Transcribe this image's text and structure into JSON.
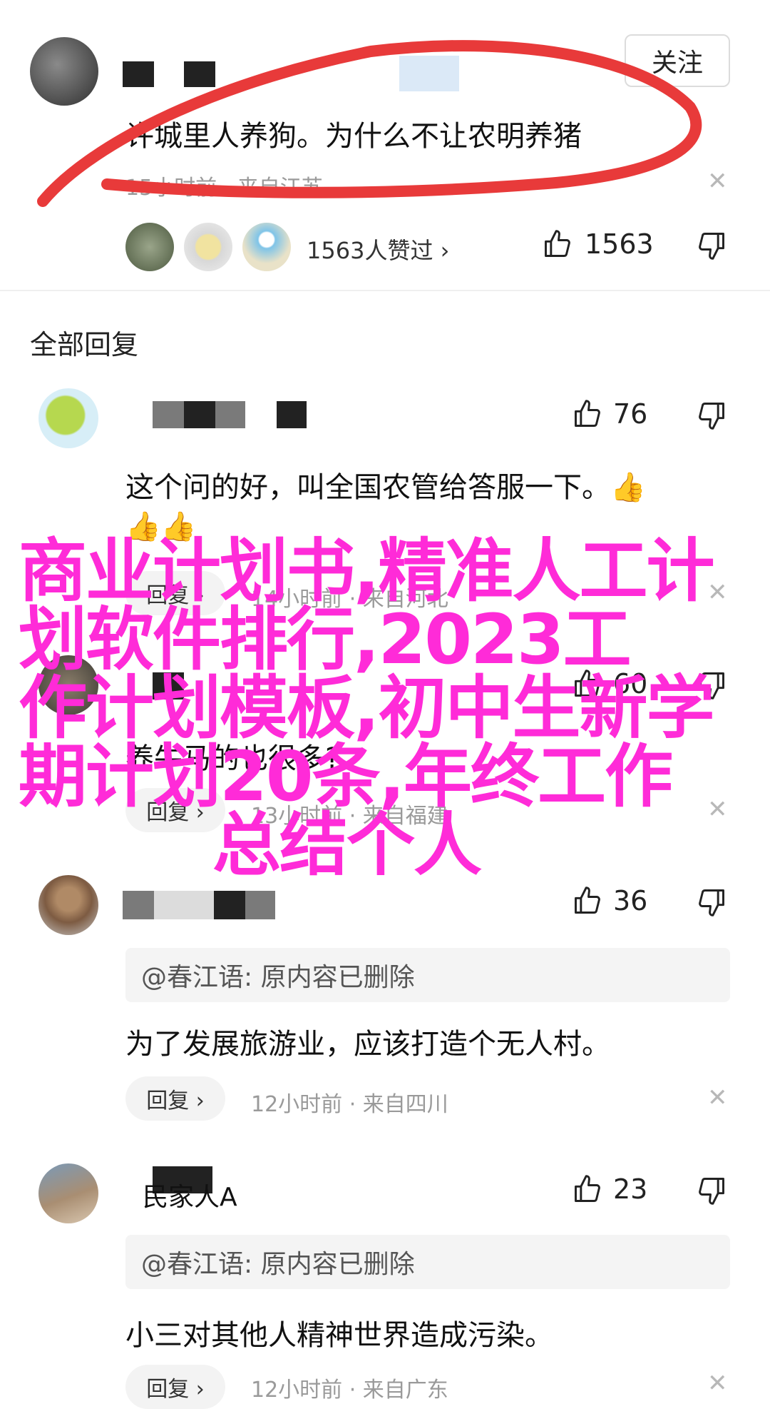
{
  "colors": {
    "overlay": "#ff2bd8",
    "annotation": "#e83a3a",
    "meta": "#9a9a9a"
  },
  "top_comment": {
    "follow_label": "关注",
    "text": "许城里人养狗。为什么不让农明养猪",
    "meta": "15小时前 · 来自江苏",
    "likers_text": "1563人赞过 ›",
    "likes": "1563",
    "icons": [
      "thumb-up-icon",
      "thumb-down-icon",
      "close-icon",
      "chevron-right-icon"
    ]
  },
  "section_title": "全部回复",
  "replies": [
    {
      "likes": "76",
      "text_line1": "这个问的好，叫全国农管给答服一下。👍",
      "text_line2": "👍👍",
      "reply_label": "回复 ›",
      "meta": "14小时前 · 来自河北"
    },
    {
      "likes": "60",
      "text": "养牛马的也很多?",
      "reply_label": "回复 ›",
      "meta": "13小时前 · 来自福建"
    },
    {
      "likes": "36",
      "quote": "@春江语: 原内容已删除",
      "text": "为了发展旅游业，应该打造个无人村。",
      "reply_label": "回复 ›",
      "meta": "12小时前 · 来自四川"
    },
    {
      "name_fragment": "民家人A",
      "likes": "23",
      "quote": "@春江语: 原内容已删除",
      "text": "小三对其他人精神世界造成污染。",
      "reply_label": "回复 ›",
      "meta": "12小时前 · 来自广东"
    }
  ],
  "overlay_lines": [
    "商业计划书,精准人工计",
    "划软件排行,2023工",
    "作计划模板,初中生新学",
    "期计划20条,年终工作",
    "总结个人"
  ]
}
